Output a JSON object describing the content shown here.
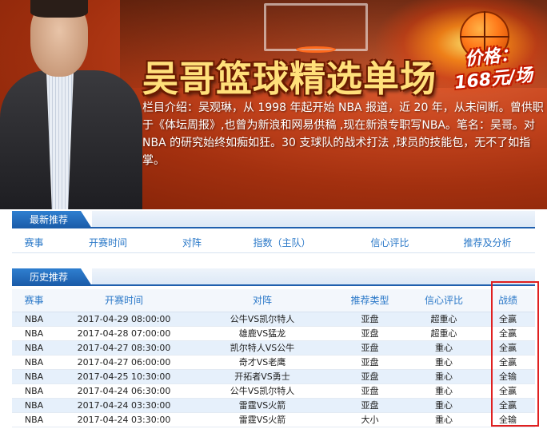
{
  "banner": {
    "title": "吴哥篮球精选单场",
    "price_line1": "价格：",
    "price_line2": "168元/场",
    "intro": "栏目介绍：吴观琳，从 1998 年起开始 NBA 报道，近 20 年，从未间断。曾供职于《体坛周报》,也曾为新浪和网易供稿 ,现在新浪专职写NBA。笔名：吴哥。对 NBA 的研究始终如痴如狂。30 支球队的战术打法 ,球员的技能包，无不了如指掌。"
  },
  "latest": {
    "section_label": "最新推荐",
    "headers": [
      "赛事",
      "开赛时间",
      "对阵",
      "指数（主队）",
      "信心评比",
      "推荐及分析"
    ]
  },
  "history": {
    "section_label": "历史推荐",
    "headers": [
      "赛事",
      "开赛时间",
      "对阵",
      "推荐类型",
      "信心评比",
      "战绩"
    ],
    "rows": [
      [
        "NBA",
        "2017-04-29 08:00:00",
        "公牛VS凯尔特人",
        "亚盘",
        "超重心",
        "全赢"
      ],
      [
        "NBA",
        "2017-04-28 07:00:00",
        "雄鹿VS猛龙",
        "亚盘",
        "超重心",
        "全赢"
      ],
      [
        "NBA",
        "2017-04-27 08:30:00",
        "凯尔特人VS公牛",
        "亚盘",
        "重心",
        "全赢"
      ],
      [
        "NBA",
        "2017-04-27 06:00:00",
        "奇才VS老鹰",
        "亚盘",
        "重心",
        "全赢"
      ],
      [
        "NBA",
        "2017-04-25 10:30:00",
        "开拓者VS勇士",
        "亚盘",
        "重心",
        "全输"
      ],
      [
        "NBA",
        "2017-04-24 06:30:00",
        "公牛VS凯尔特人",
        "亚盘",
        "重心",
        "全赢"
      ],
      [
        "NBA",
        "2017-04-24 03:30:00",
        "雷霆VS火箭",
        "亚盘",
        "重心",
        "全赢"
      ],
      [
        "NBA",
        "2017-04-24 03:30:00",
        "雷霆VS火箭",
        "大小",
        "重心",
        "全输"
      ]
    ]
  },
  "colors": {
    "accent_blue": "#1f5fae",
    "header_text_blue": "#2a78c8",
    "highlight_red": "#e02020",
    "title_yellow": "#ffe07a"
  }
}
